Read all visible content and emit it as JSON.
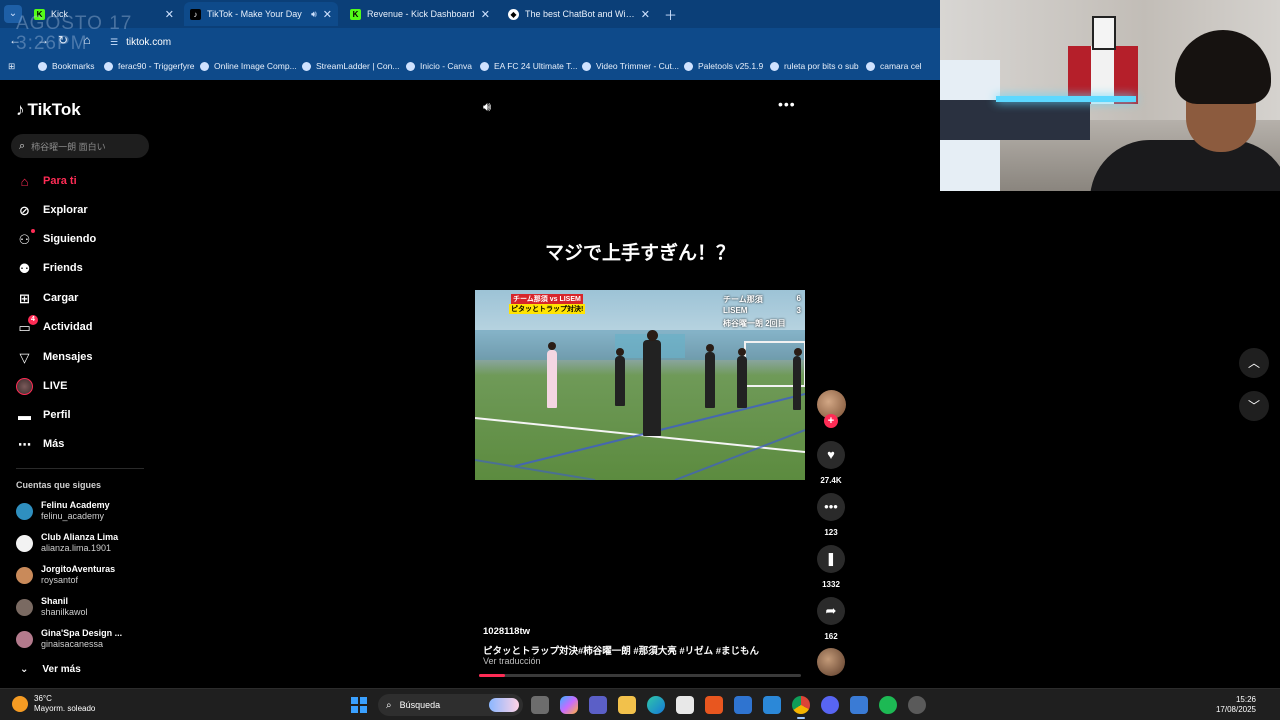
{
  "browser": {
    "tabs": [
      {
        "label": "Kick",
        "favicon": "kick-icon",
        "active": false
      },
      {
        "label": "TikTok - Make Your Day",
        "favicon": "tiktok-icon",
        "active": true
      },
      {
        "label": "Revenue - Kick Dashboard",
        "favicon": "kick-icon",
        "active": false
      },
      {
        "label": "The best ChatBot and Widgets",
        "favicon": "streamelements-icon",
        "active": false
      }
    ],
    "url": "tiktok.com",
    "bookmarks": [
      "Bookmarks",
      "ferac90 - Triggerfyre",
      "Online Image Comp...",
      "StreamLadder | Con...",
      "Inicio - Canva",
      "EA FC 24 Ultimate T...",
      "Video Trimmer - Cut...",
      "Paletools v25.1.9",
      "ruleta por bits o sub",
      "camara cel"
    ],
    "overlay_date": "AGOSTO 17",
    "overlay_time": "3:26PM"
  },
  "sidebar": {
    "brand": "TikTok",
    "search_placeholder": "柿谷曜一朗 面白い",
    "nav": [
      {
        "label": "Para ti",
        "icon": "home-icon",
        "active": true
      },
      {
        "label": "Explorar",
        "icon": "compass-icon"
      },
      {
        "label": "Siguiendo",
        "icon": "following-icon"
      },
      {
        "label": "Friends",
        "icon": "friends-icon"
      },
      {
        "label": "Cargar",
        "icon": "upload-icon"
      },
      {
        "label": "Actividad",
        "icon": "activity-icon",
        "badge": "4"
      },
      {
        "label": "Mensajes",
        "icon": "messages-icon"
      },
      {
        "label": "LIVE",
        "icon": "live-icon"
      },
      {
        "label": "Perfil",
        "icon": "profile-icon"
      },
      {
        "label": "Más",
        "icon": "more-icon"
      }
    ],
    "following_title": "Cuentas que sigues",
    "following": [
      {
        "name": "Felinu Academy",
        "handle": "felinu_academy",
        "color": "#2f8fbf"
      },
      {
        "name": "Club Alianza Lima",
        "handle": "alianza.lima.1901",
        "color": "#f2f2f2"
      },
      {
        "name": "JorgitoAventuras",
        "handle": "roysantof",
        "color": "#c98a5a"
      },
      {
        "name": "Shanil",
        "handle": "shanilkawol",
        "color": "#7a6a62"
      },
      {
        "name": "Gina'Spa Design ...",
        "handle": "ginaisacanessa",
        "color": "#b37a8c"
      }
    ],
    "see_more": "Ver más"
  },
  "video": {
    "headline": "マジで上手すぎん！？",
    "overlay_tag": "チーム那須 vs LISEM",
    "overlay_sub": "ピタッとトラップ対決!",
    "score_rows": [
      {
        "team": "チーム那須",
        "score": "6"
      },
      {
        "team": "LISEM",
        "score": "3"
      },
      {
        "team": "柿谷曜一朗 2回目",
        "score": ""
      }
    ],
    "author": "1028118tw",
    "caption": "ピタッとトラップ対決#柿谷曜一朗 #那須大亮 #リゼム #まじもん",
    "translate": "Ver traducción",
    "progress": 0.08
  },
  "actions": {
    "likes": "27.4K",
    "comments": "123",
    "saves": "1332",
    "shares": "162"
  },
  "taskbar": {
    "temperature": "36°C",
    "weather": "Mayorm. soleado",
    "search": "Búsqueda",
    "time": "15:26",
    "date": "17/08/2025"
  },
  "colors": {
    "accent": "#fe2c55",
    "chrome": "#0e4a8a"
  }
}
